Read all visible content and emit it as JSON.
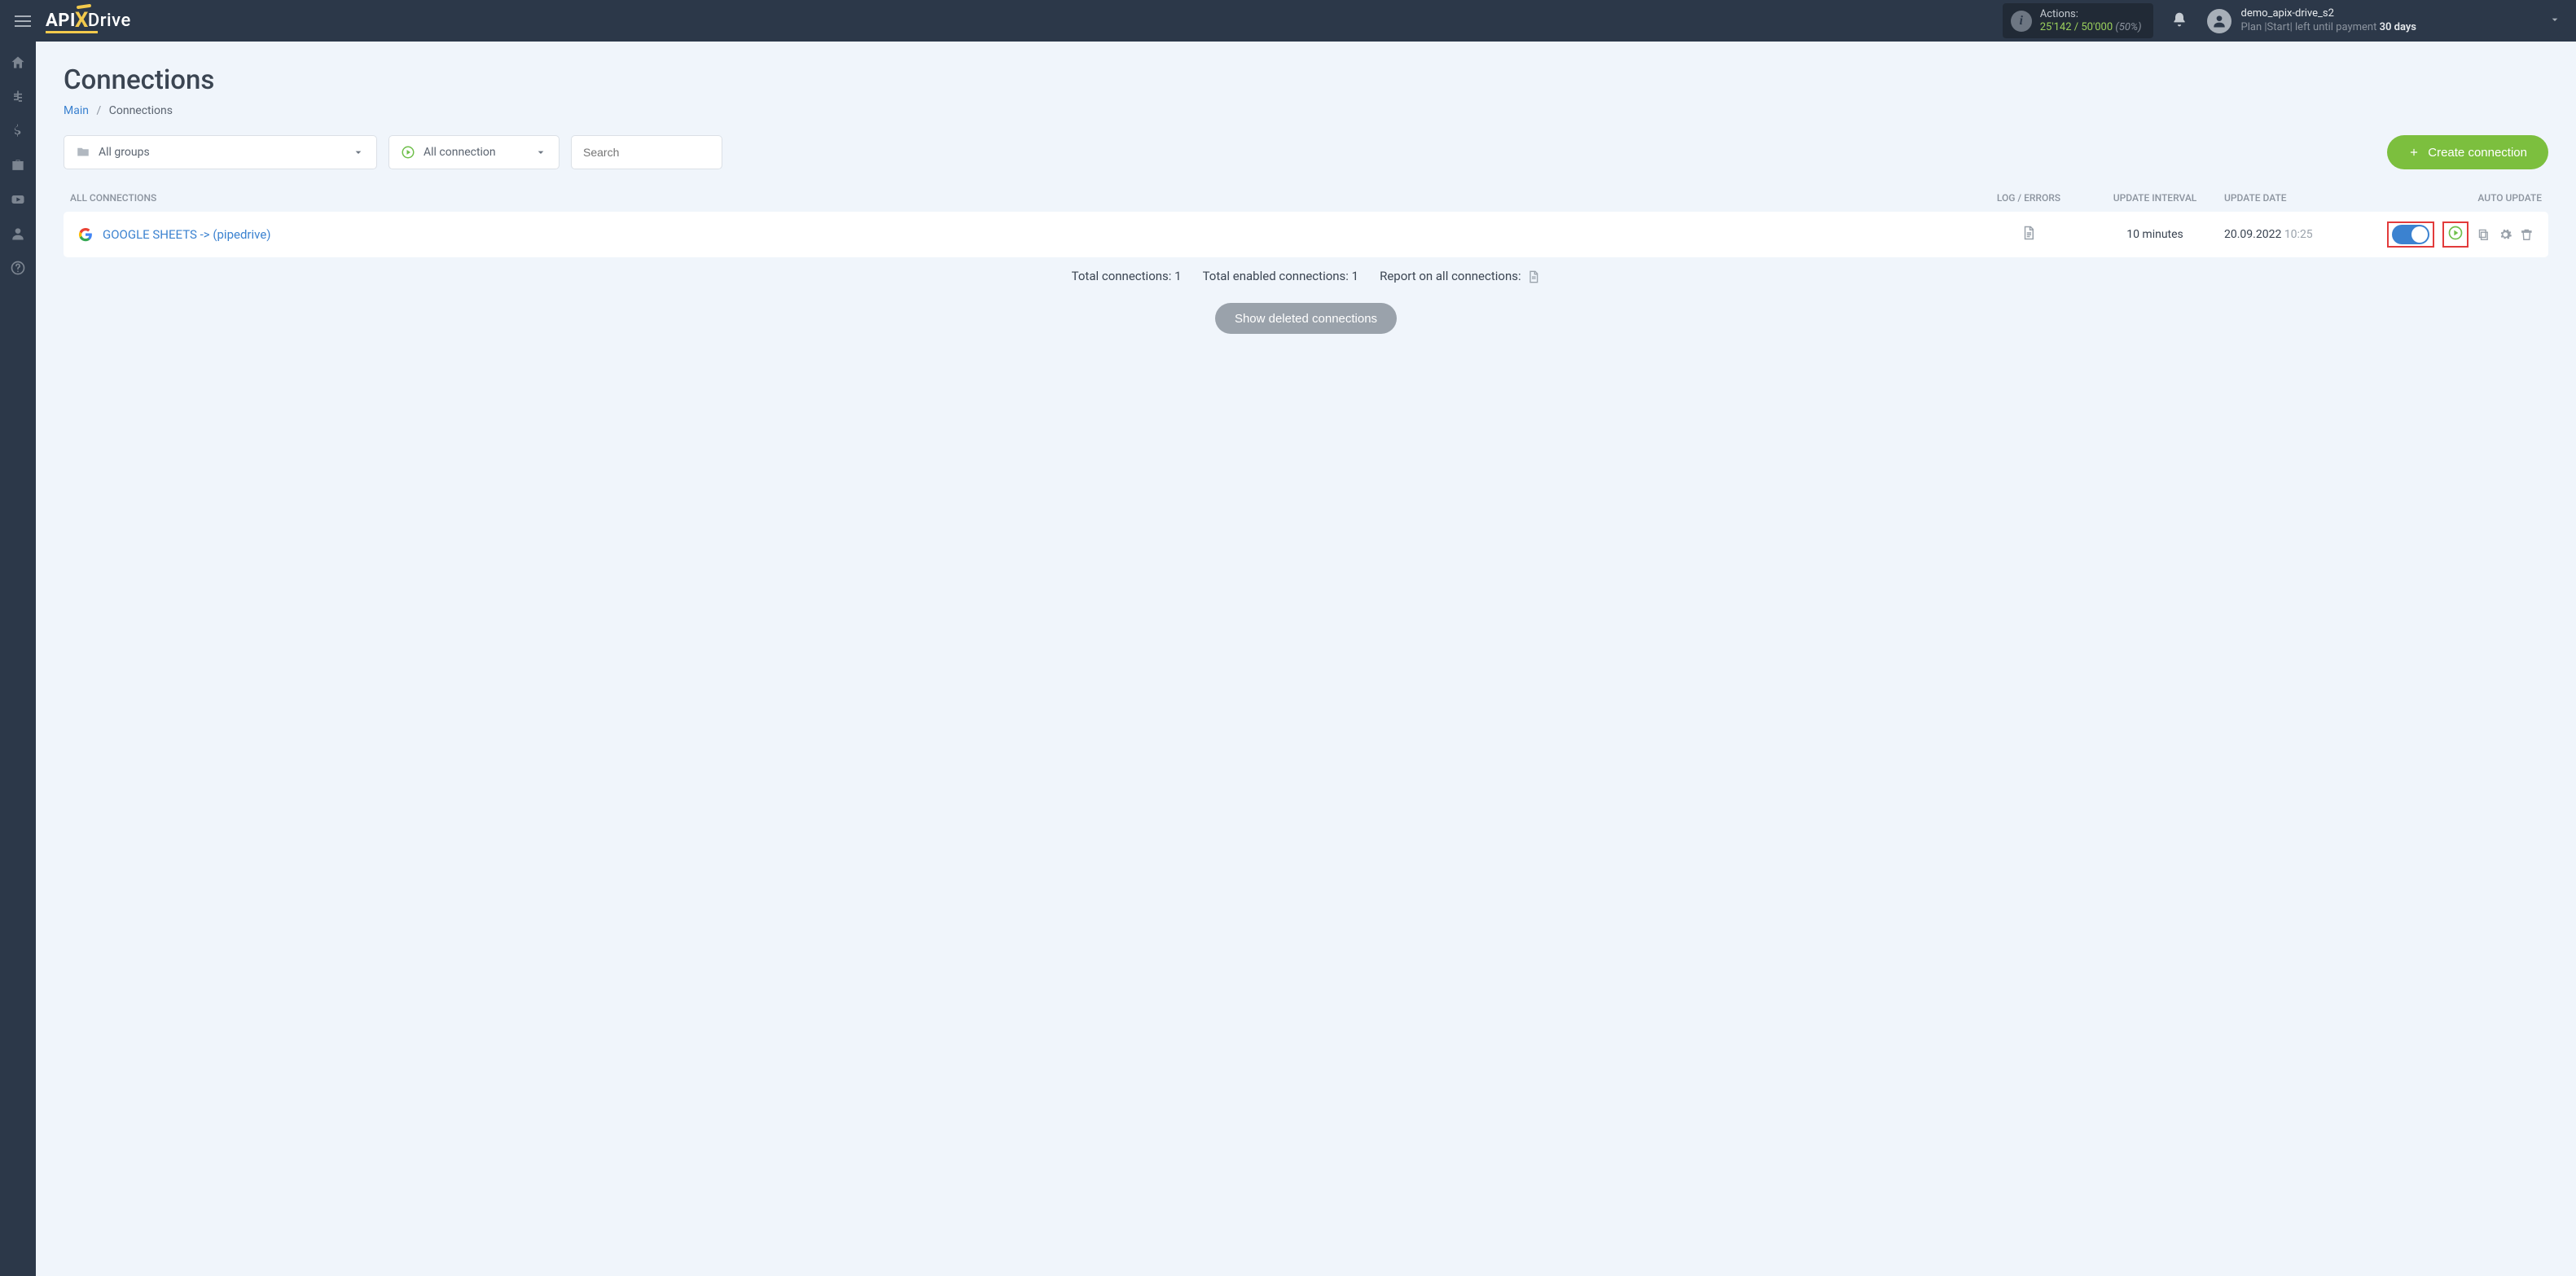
{
  "header": {
    "actions_label": "Actions:",
    "actions_used": "25'142",
    "actions_limit": "/ 50'000",
    "actions_pct": "(50%)",
    "user_name": "demo_apix-drive_s2",
    "plan_prefix": "Plan |Start| left until payment ",
    "plan_days": "30 days"
  },
  "page": {
    "title": "Connections",
    "breadcrumb_main": "Main",
    "breadcrumb_current": "Connections"
  },
  "filters": {
    "groups_label": "All groups",
    "status_label": "All connection",
    "search_placeholder": "Search",
    "create_btn": "Create connection"
  },
  "columns": {
    "name": "ALL CONNECTIONS",
    "log": "LOG / ERRORS",
    "interval": "UPDATE INTERVAL",
    "date": "UPDATE DATE",
    "auto": "AUTO UPDATE"
  },
  "rows": [
    {
      "name": "GOOGLE SHEETS -> (pipedrive)",
      "interval": "10 minutes",
      "date": "20.09.2022",
      "time": "10:25"
    }
  ],
  "summary": {
    "total": "Total connections: 1",
    "enabled": "Total enabled connections: 1",
    "report": "Report on all connections:"
  },
  "buttons": {
    "show_deleted": "Show deleted connections"
  }
}
